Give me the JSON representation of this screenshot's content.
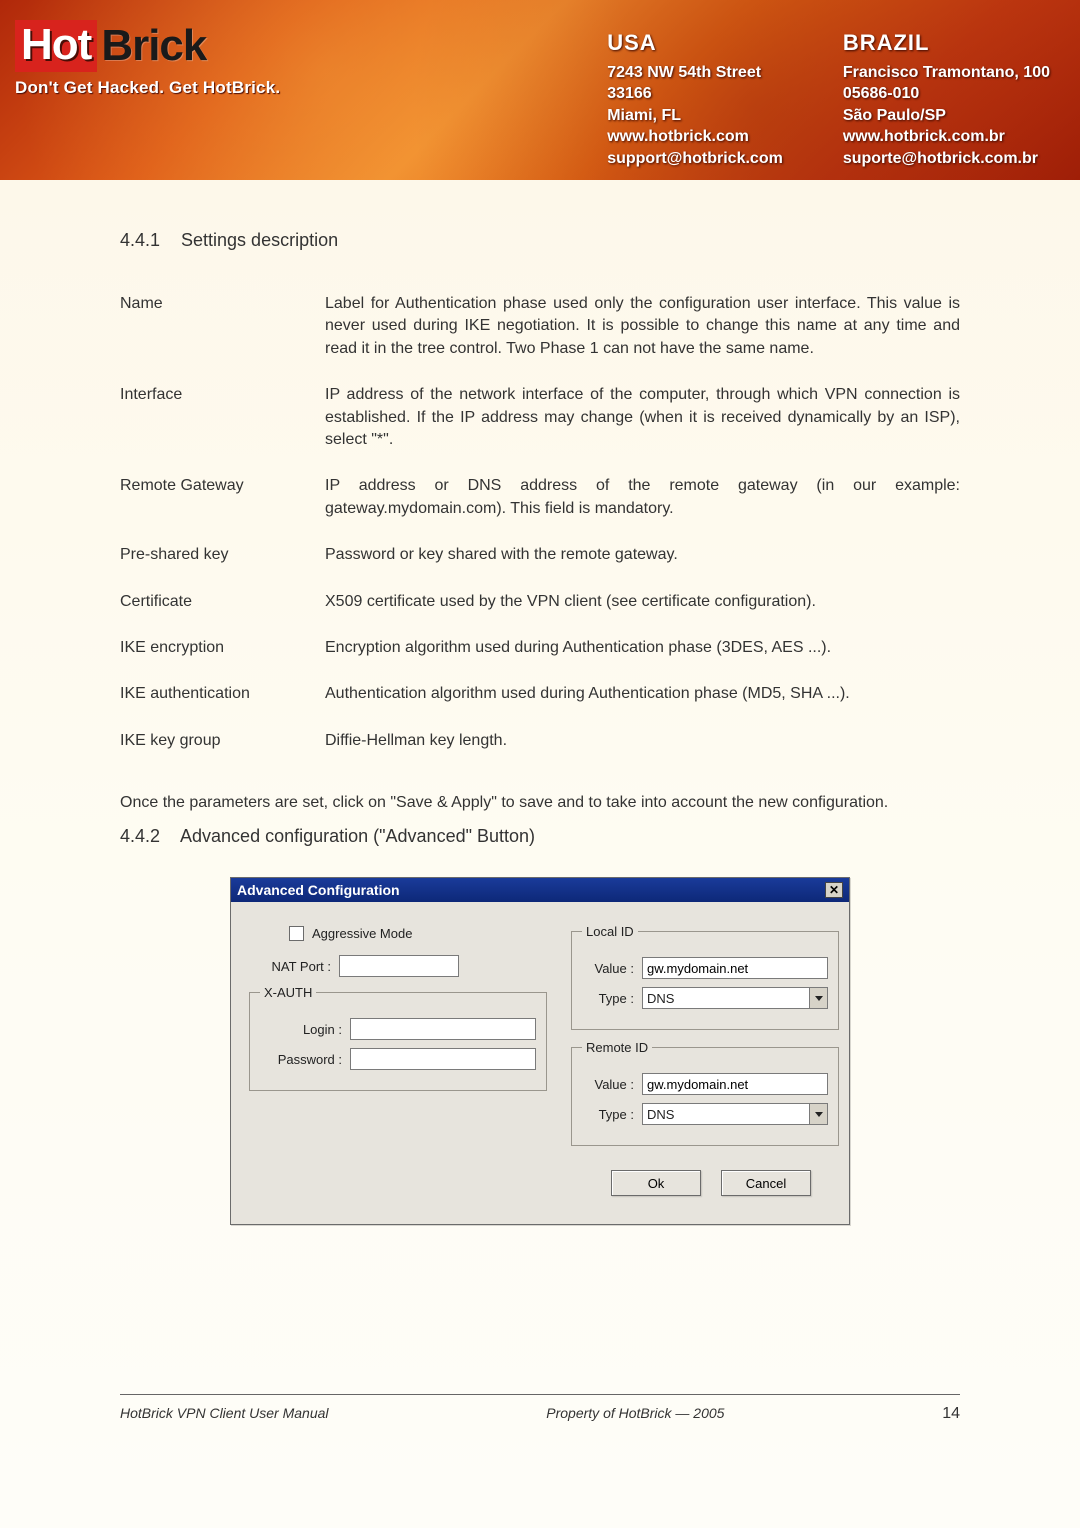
{
  "header": {
    "logo_hot": "Hot",
    "logo_brick": "Brick",
    "tagline": "Don't Get Hacked. Get HotBrick.",
    "usa": {
      "country": "USA",
      "line1": "7243 NW 54th Street",
      "line2": "33166",
      "line3": "Miami, FL",
      "line4": "www.hotbrick.com",
      "line5": "support@hotbrick.com"
    },
    "brazil": {
      "country": "BRAZIL",
      "line1": "Francisco Tramontano, 100",
      "line2": "05686-010",
      "line3": "São Paulo/SP",
      "line4": "www.hotbrick.com.br",
      "line5": "suporte@hotbrick.com.br"
    }
  },
  "section441": {
    "num": "4.4.1",
    "title": "Settings description"
  },
  "settings": [
    {
      "term": "Name",
      "desc": "Label for Authentication phase used only the configuration user interface. This value is never used during IKE negotiation. It is possible to change this name at any time and read it in the tree control. Two Phase 1 can not have the same name."
    },
    {
      "term": "Interface",
      "desc": "IP address of the network interface of the computer, through which VPN connection is established. If the IP address may change (when it is received dynamically by an ISP), select \"*\"."
    },
    {
      "term": "Remote Gateway",
      "desc": "IP address or DNS address of the remote gateway (in our example: gateway.mydomain.com). This field is mandatory."
    },
    {
      "term": "Pre-shared key",
      "desc": "Password or key shared with the remote gateway."
    },
    {
      "term": "Certificate",
      "desc": "X509 certificate used by the VPN client (see certificate configuration)."
    },
    {
      "term": "IKE encryption",
      "desc": "Encryption algorithm used during Authentication phase (3DES, AES ...)."
    },
    {
      "term": "IKE authentication",
      "desc": "Authentication algorithm used during Authentication phase (MD5, SHA ...)."
    },
    {
      "term": "IKE key group",
      "desc": "Diffie-Hellman key length."
    }
  ],
  "para_save": "Once the parameters are set, click on \"Save & Apply\" to save and to take into account the new configuration.",
  "section442": {
    "num": "4.4.2",
    "title": "Advanced configuration (\"Advanced\" Button)"
  },
  "dialog": {
    "title": "Advanced Configuration",
    "aggressive": "Aggressive Mode",
    "nat_port_label": "NAT Port :",
    "nat_port_value": "",
    "xauth_legend": "X-AUTH",
    "login_label": "Login :",
    "login_value": "",
    "password_label": "Password :",
    "password_value": "",
    "localid_legend": "Local ID",
    "remoteid_legend": "Remote ID",
    "value_label": "Value :",
    "type_label": "Type :",
    "local_value": "gw.mydomain.net",
    "local_type": "DNS",
    "remote_value": "gw.mydomain.net",
    "remote_type": "DNS",
    "ok": "Ok",
    "cancel": "Cancel"
  },
  "footer": {
    "left": "HotBrick VPN Client User Manual",
    "right": "Property of HotBrick — 2005",
    "page": "14"
  }
}
